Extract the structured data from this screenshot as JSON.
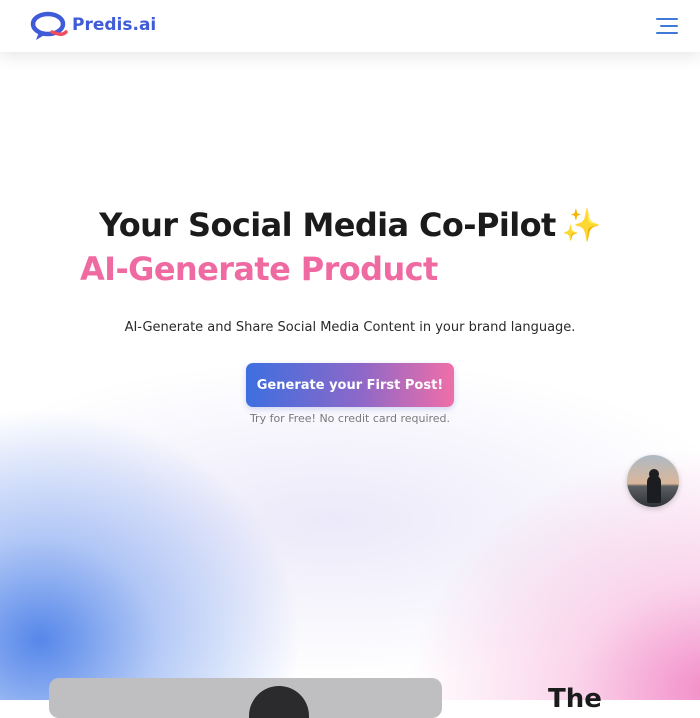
{
  "brand": {
    "name": "Predis.ai"
  },
  "hero": {
    "title": "Your Social Media Co-Pilot",
    "title_emoji": "✨",
    "subtitle": "AI-Generate Product",
    "description": "AI-Generate and Share Social Media Content in your brand language.",
    "cta_label": "Generate your First Post!",
    "cta_note": "Try for Free! No credit card required."
  },
  "next_section": {
    "heading_partial": "The"
  },
  "icons": {
    "menu": "hamburger-menu-icon",
    "logo": "speech-bubble-logo-icon",
    "sparkles": "sparkles-emoji"
  },
  "colors": {
    "brand_blue": "#3f5bd8",
    "headline": "#1b1b1b",
    "accent_pink": "#f06aa2",
    "cta_gradient_start": "#3d6fe0",
    "cta_gradient_end": "#f06ea8"
  }
}
